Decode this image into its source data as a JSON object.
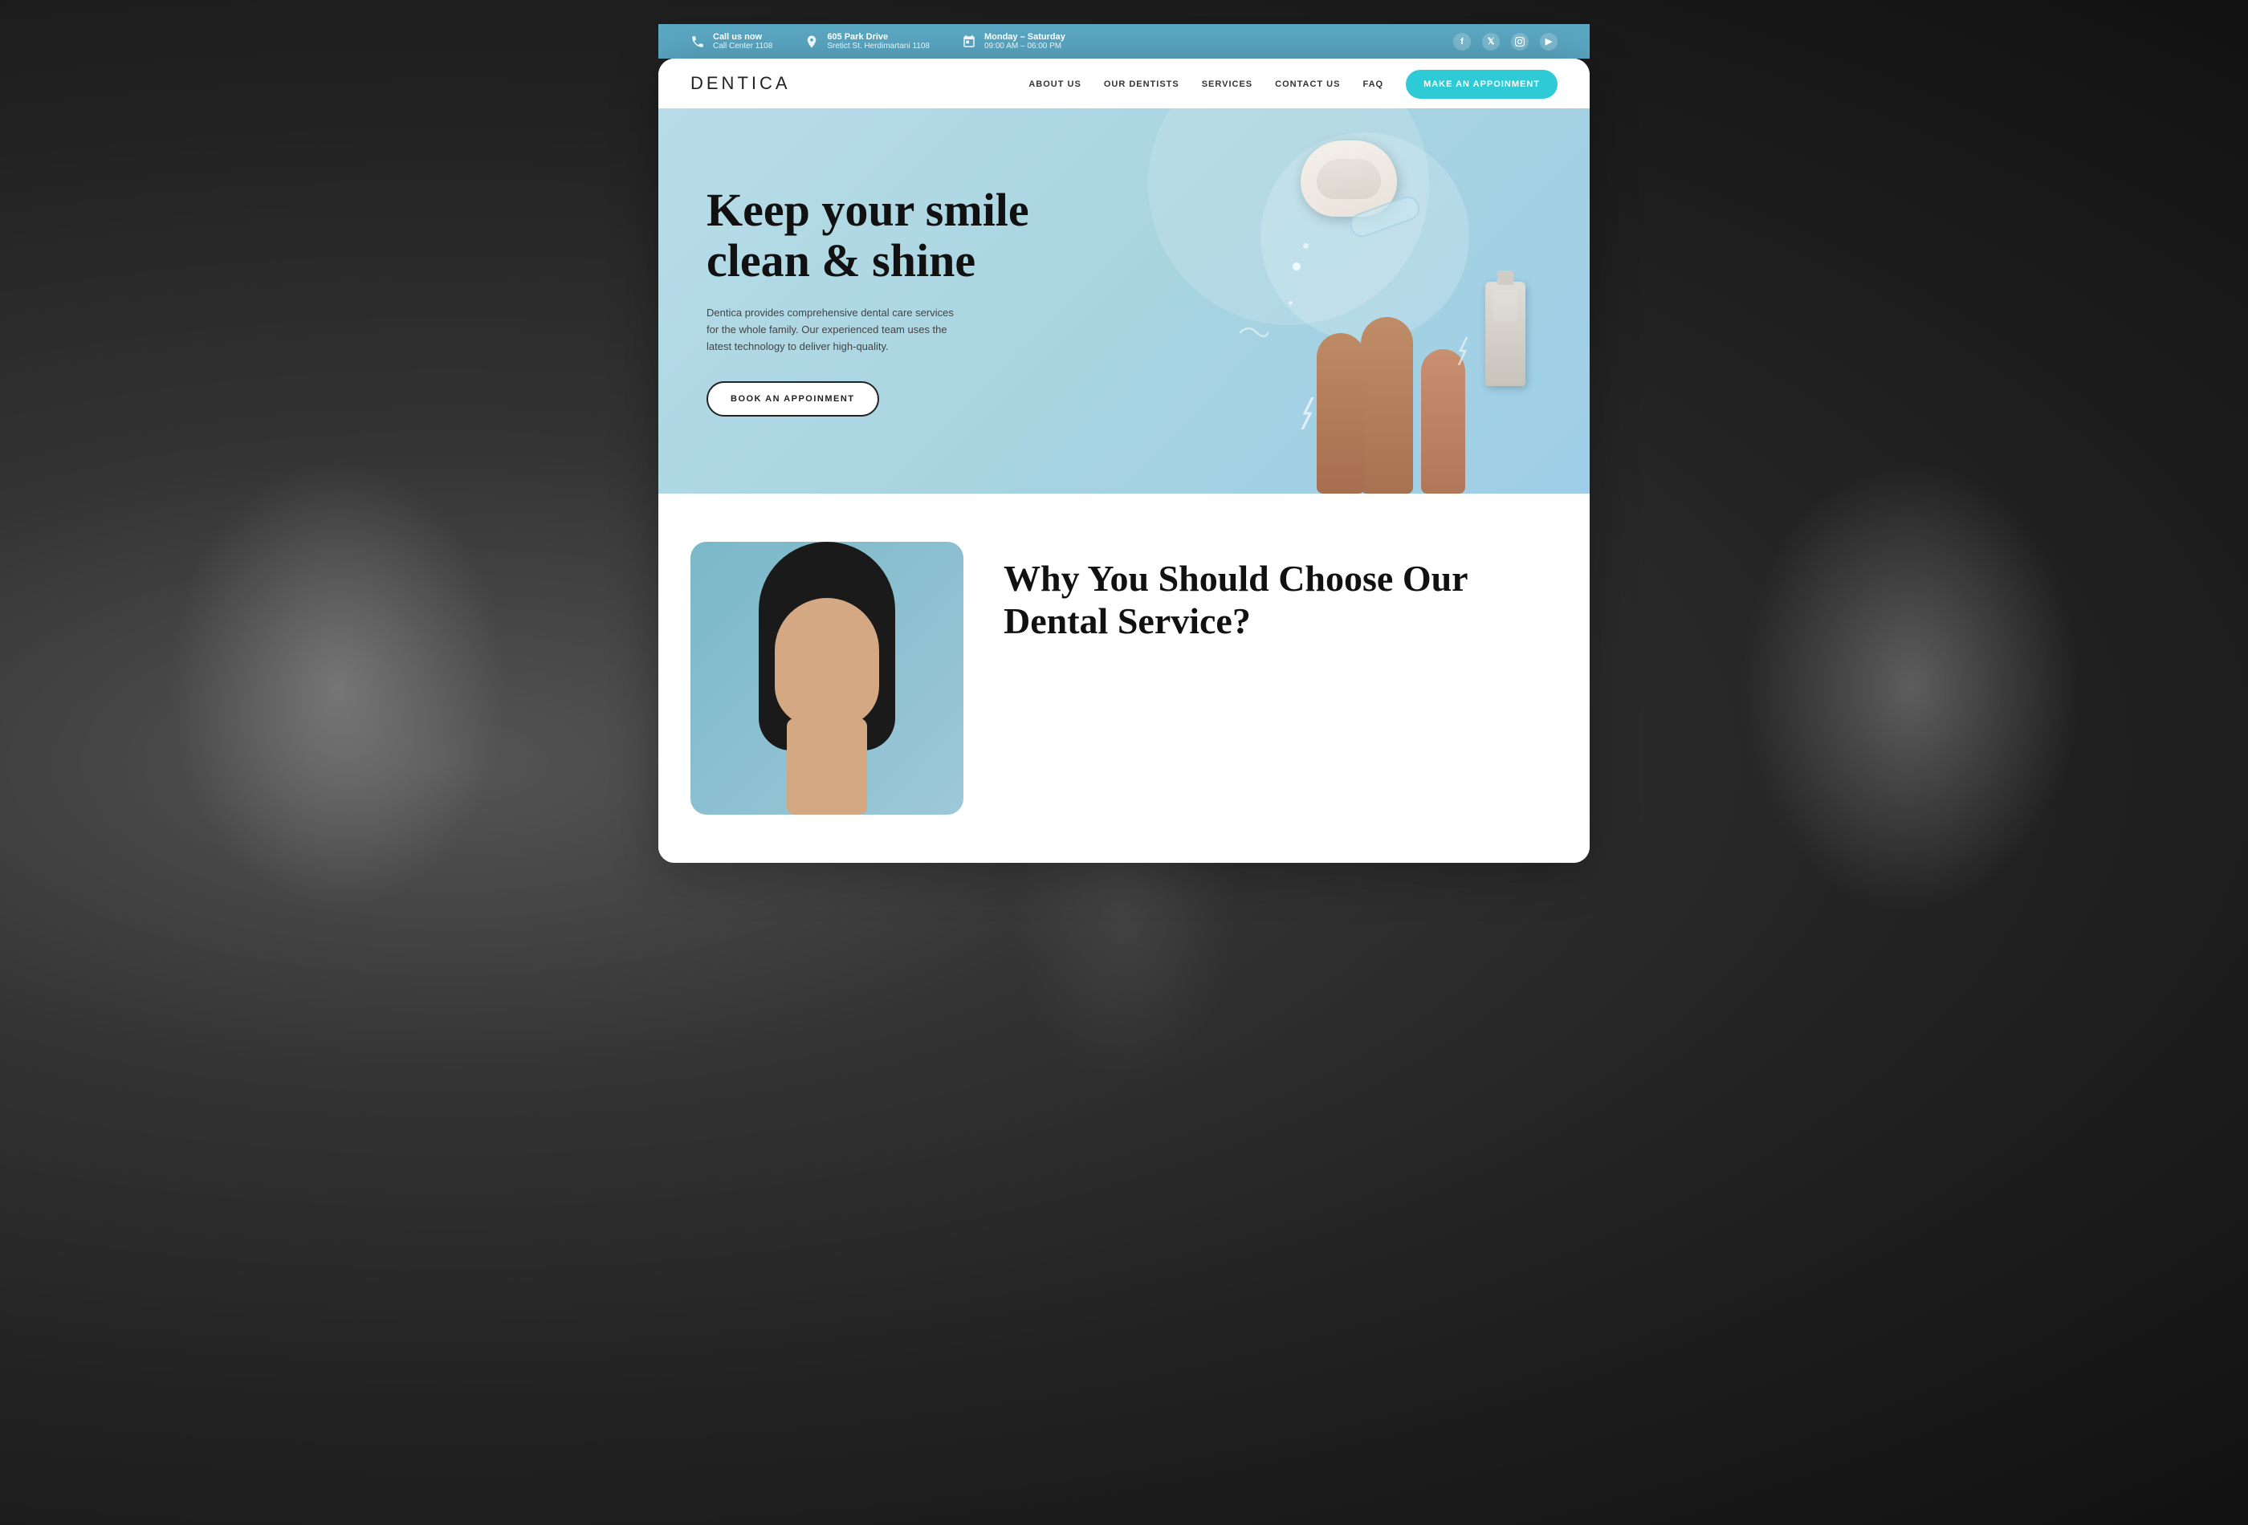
{
  "topbar": {
    "phone": {
      "label": "Call us now",
      "sublabel": "Call Center 1108",
      "icon": "phone-icon"
    },
    "address": {
      "label": "605 Park Drive",
      "sublabel": "Sretict St. Herdimartani 1108",
      "icon": "location-icon"
    },
    "hours": {
      "label": "Monday – Saturday",
      "sublabel": "09:00 AM – 06:00 PM",
      "icon": "calendar-icon"
    },
    "social": [
      {
        "name": "facebook",
        "label": "f"
      },
      {
        "name": "twitter",
        "label": "t"
      },
      {
        "name": "instagram",
        "label": "in"
      },
      {
        "name": "youtube",
        "label": "▶"
      }
    ]
  },
  "navbar": {
    "logo": "DENTICA",
    "links": [
      {
        "label": "ABOUT US",
        "href": "#"
      },
      {
        "label": "OUR DENTISTS",
        "href": "#"
      },
      {
        "label": "SERVICES",
        "href": "#"
      },
      {
        "label": "CONTACT US",
        "href": "#"
      },
      {
        "label": "FAQ",
        "href": "#"
      }
    ],
    "cta": "MAKE AN APPOINMENT"
  },
  "hero": {
    "title": "Keep your smile clean & shine",
    "description": "Dentica provides comprehensive dental care services for the whole family. Our experienced team uses the latest technology to deliver high-quality.",
    "cta": "BOOK AN APPOINMENT"
  },
  "section2": {
    "title": "Why You Should Choose Our Dental Service?",
    "image_alt": "Woman portrait"
  },
  "colors": {
    "topbar_bg": "#5ba8c4",
    "cta_bg": "#2ecad6",
    "hero_bg": "#b8dde8",
    "white": "#ffffff"
  }
}
